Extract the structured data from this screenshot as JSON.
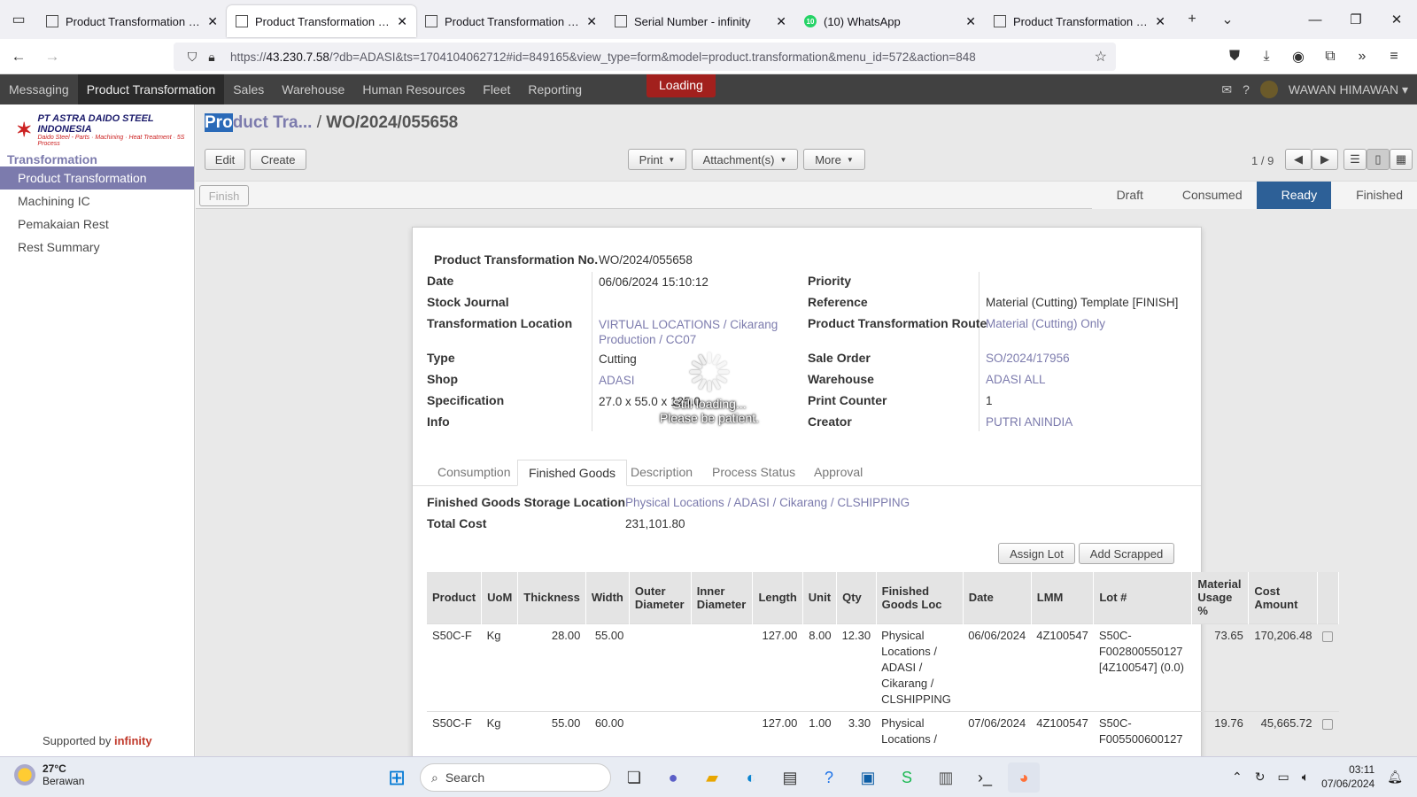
{
  "browser": {
    "tabs": [
      {
        "title": "Product Transformation - infinity",
        "active": false,
        "icon": "odoo"
      },
      {
        "title": "Product Transformation - infinity",
        "active": true,
        "icon": "odoo"
      },
      {
        "title": "Product Transformation - infinity",
        "active": false,
        "icon": "odoo"
      },
      {
        "title": "Serial Number - infinity",
        "active": false,
        "icon": "odoo"
      },
      {
        "title": "(10) WhatsApp",
        "active": false,
        "icon": "whatsapp",
        "badge": "10"
      },
      {
        "title": "Product Transformation - infinity",
        "active": false,
        "icon": "odoo"
      }
    ],
    "url_prefix": "https://",
    "url_host": "43.230.7.58",
    "url_rest": "/?db=ADASI&ts=1704104062712#id=849165&view_type=form&model=product.transformation&menu_id=572&action=848"
  },
  "appbar": {
    "menu": [
      "Messaging",
      "Product Transformation",
      "Sales",
      "Warehouse",
      "Human Resources",
      "Fleet",
      "Reporting"
    ],
    "active_index": 1,
    "loading": "Loading",
    "user": "WAWAN HIMAWAN"
  },
  "sidebar": {
    "company": "PT ASTRA DAIDO STEEL INDONESIA",
    "company_sub": "Daido Steel - Parts · Machining · Heat Treatment · 5S Process",
    "section": "Transformation",
    "items": [
      "Product Transformation",
      "Machining IC",
      "Pemakaian Rest",
      "Rest Summary"
    ],
    "active_index": 0,
    "supported_prefix": "Supported by",
    "supported_brand": "infinity"
  },
  "header": {
    "crumb_hl": "Pro",
    "crumb_rest": "duct Tra...",
    "crumb_sep": "/",
    "record": "WO/2024/055658",
    "edit": "Edit",
    "create": "Create",
    "print": "Print",
    "attachments": "Attachment(s)",
    "more": "More",
    "pager": "1 / 9",
    "finish": "Finish",
    "stages": [
      "Draft",
      "Consumed",
      "Ready",
      "Finished"
    ],
    "active_stage": 2
  },
  "form": {
    "no_label": "Product Transformation No.",
    "no_value": "WO/2024/055658",
    "left": [
      {
        "label": "Date",
        "value": "06/06/2024 15:10:12",
        "link": false
      },
      {
        "label": "Stock Journal",
        "value": "",
        "link": false
      },
      {
        "label": "Transformation Location",
        "value": "VIRTUAL LOCATIONS / Cikarang",
        "value2": "Production / CC07",
        "link": true
      },
      {
        "label": "Type",
        "value": "Cutting",
        "link": false
      },
      {
        "label": "Shop",
        "value": "ADASI",
        "link": true
      },
      {
        "label": "Specification",
        "value": "27.0 x 55.0 x 125.0",
        "link": false
      },
      {
        "label": "Info",
        "value": "",
        "link": false
      }
    ],
    "right": [
      {
        "label": "Priority",
        "value": "",
        "link": false
      },
      {
        "label": "Reference",
        "value": "Material (Cutting) Template [FINISH]",
        "link": false
      },
      {
        "label": "Product Transformation Route",
        "value": "Material (Cutting) Only",
        "link": true
      },
      {
        "label": "Sale Order",
        "value": "SO/2024/17956",
        "link": true
      },
      {
        "label": "Warehouse",
        "value": "ADASI ALL",
        "link": true
      },
      {
        "label": "Print Counter",
        "value": "1",
        "link": false
      },
      {
        "label": "Creator",
        "value": "PUTRI ANINDIA",
        "link": true
      }
    ],
    "tabs": [
      "Consumption",
      "Finished Goods",
      "Description",
      "Process Status",
      "Approval"
    ],
    "active_tab": 1,
    "fg_loc_label": "Finished Goods Storage Location",
    "fg_loc_value": "Physical Locations / ADASI / Cikarang / CLSHIPPING",
    "total_cost_label": "Total Cost",
    "total_cost_value": "231,101.80",
    "assign_lot": "Assign Lot",
    "add_scrapped": "Add Scrapped"
  },
  "table": {
    "headers": [
      "Product",
      "UoM",
      "Thickness",
      "Width",
      "Outer Diameter",
      "Inner Diameter",
      "Length",
      "Unit",
      "Qty",
      "Finished Goods Loc",
      "Date",
      "LMM",
      "Lot #",
      "Material Usage %",
      "Cost Amount"
    ],
    "rows": [
      [
        "S50C-F",
        "Kg",
        "28.00",
        "55.00",
        "",
        "",
        "127.00",
        "8.00",
        "12.30",
        "Physical Locations / ADASI / Cikarang / CLSHIPPING",
        "06/06/2024",
        "4Z100547",
        "S50C-F002800550127 [4Z100547] (0.0)",
        "73.65",
        "170,206.48"
      ],
      [
        "S50C-F",
        "Kg",
        "55.00",
        "60.00",
        "",
        "",
        "127.00",
        "1.00",
        "3.30",
        "Physical Locations /",
        "07/06/2024",
        "4Z100547",
        "S50C-F005500600127",
        "19.76",
        "45,665.72"
      ]
    ]
  },
  "overlay": {
    "line1": "Still loading...",
    "line2": "Please be patient."
  },
  "taskbar": {
    "temp": "27°C",
    "weather": "Berawan",
    "search": "Search",
    "time": "03:11",
    "date": "07/06/2024"
  }
}
